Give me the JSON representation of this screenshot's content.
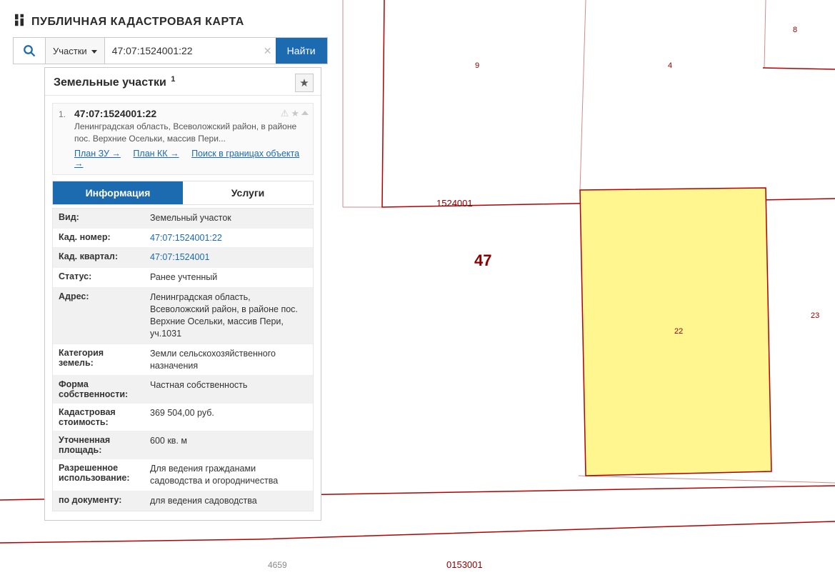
{
  "app": {
    "title": "ПУБЛИЧНАЯ КАДАСТРОВАЯ КАРТА"
  },
  "search": {
    "type_label": "Участки",
    "value": "47:07:1524001:22",
    "find_label": "Найти"
  },
  "panel": {
    "title": "Земельные участки",
    "count": "1",
    "item": {
      "num": "1.",
      "id": "47:07:1524001:22",
      "address": "Ленинградская область, Всеволожский район, в районе пос. Верхние Осельки, массив Пери...",
      "link_plan_zu": "План ЗУ →",
      "link_plan_kk": "План КК →",
      "link_search_bounds": "Поиск в границах объекта →"
    },
    "tabs": {
      "info": "Информация",
      "services": "Услуги"
    },
    "props": [
      {
        "label": "Вид:",
        "value": "Земельный участок"
      },
      {
        "label": "Кад. номер:",
        "value": "47:07:1524001:22",
        "link": true
      },
      {
        "label": "Кад. квартал:",
        "value": "47:07:1524001",
        "link": true
      },
      {
        "label": "Статус:",
        "value": "Ранее учтенный"
      },
      {
        "label": "Адрес:",
        "value": "Ленинградская область, Всеволожский район, в районе пос. Верхние Осельки, массив Пери, уч.1031"
      },
      {
        "label": "Категория земель:",
        "value": "Земли сельскохозяйственного назначения"
      },
      {
        "label": "Форма собственности:",
        "value": "Частная собственность"
      },
      {
        "label": "Кадастровая стоимость:",
        "value": "369 504,00 руб."
      },
      {
        "label": "Уточненная площадь:",
        "value": "600 кв. м"
      },
      {
        "label": "Разрешенное использование:",
        "value": "Для ведения гражданами садоводства и огородничества"
      },
      {
        "label": "по документу:",
        "value": "для ведения садоводства"
      }
    ]
  },
  "map": {
    "region_label": "47",
    "quarter_label_top": "1524001",
    "quarter_label_bottom": "0153001",
    "parcel_labels": {
      "p4": "4",
      "p8": "8",
      "p9": "9",
      "p22": "22",
      "p23": "23",
      "p4659": "4659"
    }
  }
}
